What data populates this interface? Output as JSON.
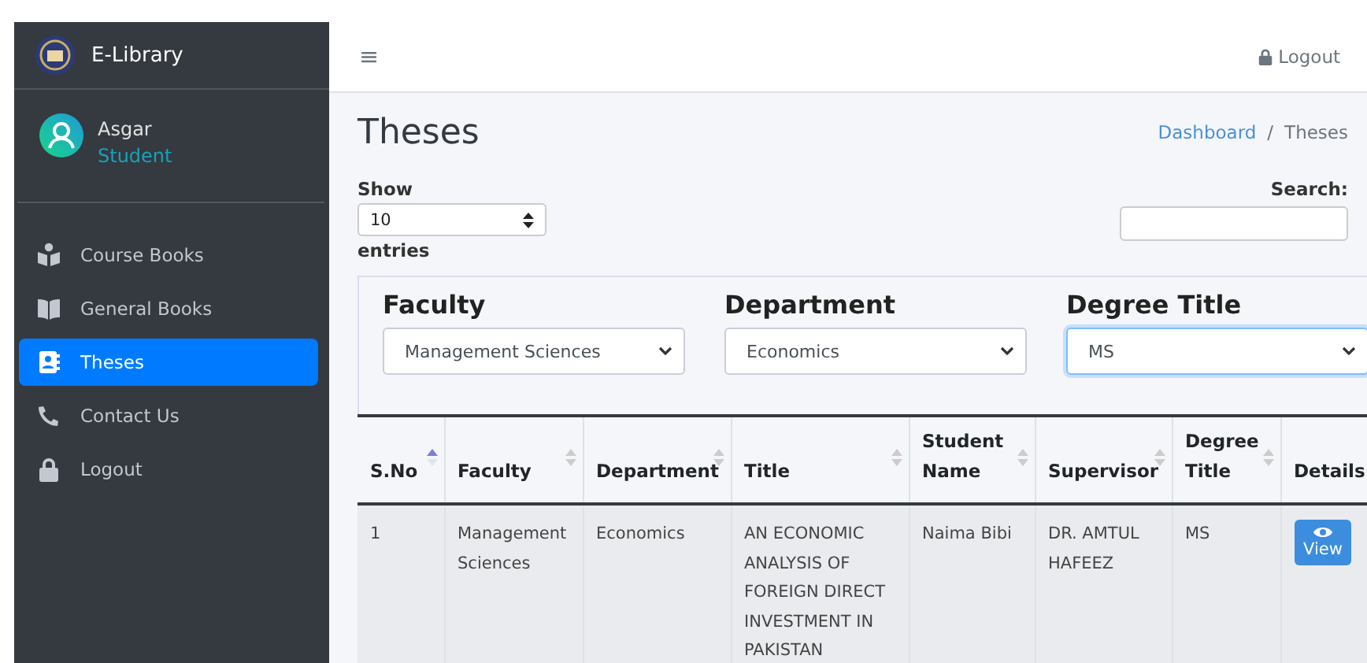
{
  "sidebar": {
    "brand": "E-Library",
    "user": {
      "name": "Asgar",
      "role": "Student"
    },
    "items": [
      {
        "label": "Course Books",
        "selected": false
      },
      {
        "label": "General Books",
        "selected": false
      },
      {
        "label": "Theses",
        "selected": true
      },
      {
        "label": "Contact Us",
        "selected": false
      },
      {
        "label": "Logout",
        "selected": false
      }
    ]
  },
  "topbar": {
    "menu_icon": "≡",
    "logout": "Logout"
  },
  "page": {
    "title": "Theses",
    "breadcrumb": [
      {
        "label": "Dashboard",
        "link": true
      },
      {
        "label": "Theses",
        "link": false
      }
    ],
    "breadcrumb_separator": "/"
  },
  "length": {
    "before": "Show",
    "value": "10",
    "after": "entries"
  },
  "search": {
    "label": "Search:"
  },
  "filters": [
    {
      "label": "Faculty",
      "value": "Management Sciences",
      "focused": false
    },
    {
      "label": "Department",
      "value": "Economics",
      "focused": false
    },
    {
      "label": "Degree Title",
      "value": "MS",
      "focused": true
    }
  ],
  "table": {
    "columns": [
      {
        "label": "S.No",
        "kind": "sortable",
        "sorted": true
      },
      {
        "label": "Faculty",
        "kind": "sortable",
        "sorted": false
      },
      {
        "label": "Department",
        "kind": "sortable",
        "sorted": false
      },
      {
        "label": "Title",
        "kind": "sortable",
        "sorted": false
      },
      {
        "label": "Student Name",
        "kind": "sortable",
        "sorted": false
      },
      {
        "label": "Supervisor",
        "kind": "sortable",
        "sorted": false
      },
      {
        "label": "Degree Title",
        "kind": "sortable",
        "sorted": false
      },
      {
        "label": "Details",
        "kind": "plain"
      }
    ],
    "rows": [
      {
        "cells": [
          "1",
          "Management Sciences",
          "Economics",
          "AN ECONOMIC ANALYSIS OF FOREIGN DIRECT INVESTMENT IN PAKISTAN",
          "Naima Bibi",
          "DR. AMTUL HAFEEZ",
          "MS"
        ],
        "action": "View"
      }
    ]
  }
}
